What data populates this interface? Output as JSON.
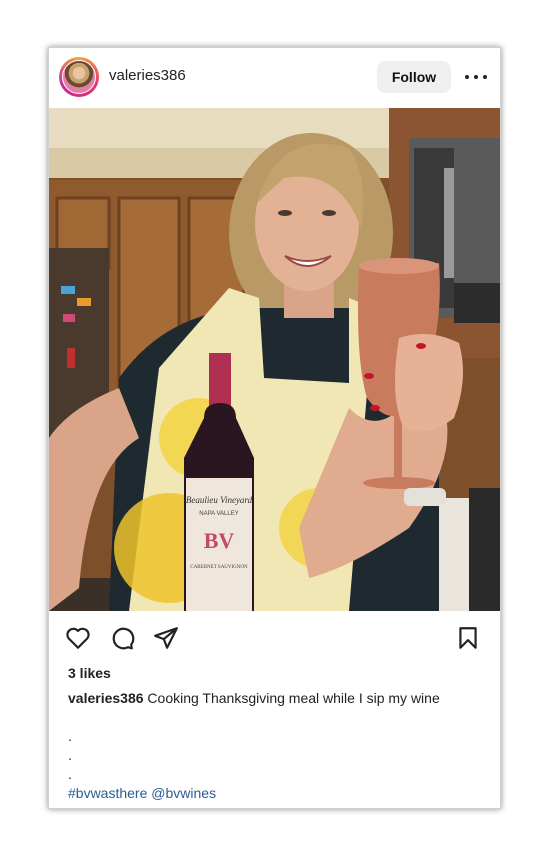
{
  "post": {
    "username": "valeries386",
    "follow_label": "Follow",
    "likes": "3 likes",
    "caption_user": "valeries386",
    "caption_text": "Cooking Thanksgiving meal while I sip my wine",
    "dots": [
      ".",
      ".",
      "."
    ],
    "hashtag": "#bvwasthere",
    "mention": "@bvwines"
  },
  "photo": {
    "label_brand": "BV",
    "label_script": "Beaulieu Vineyard",
    "label_region": "NAPA VALLEY",
    "label_varietal": "CABERNET SAUVIGNON"
  },
  "icons": {
    "like": "heart-icon",
    "comment": "comment-icon",
    "share": "send-icon",
    "save": "bookmark-icon",
    "more": "more-dots-icon"
  },
  "colors": {
    "link": "#2a5c94",
    "button_bg": "#efefef"
  }
}
